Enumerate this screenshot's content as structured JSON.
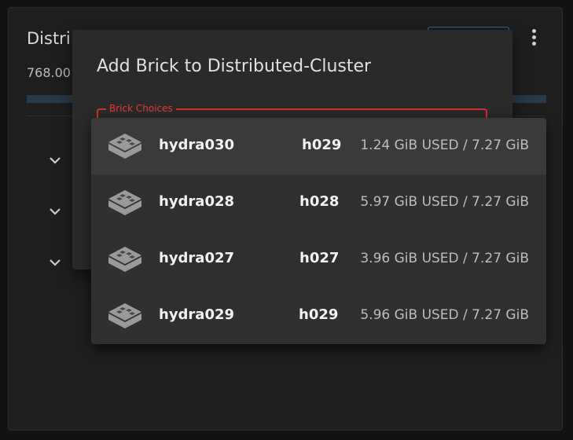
{
  "background_card": {
    "title": "Distri",
    "subtitle": "768.00"
  },
  "dialog": {
    "title": "Add Brick to Distributed-Cluster",
    "field_label": "Brick Choices"
  },
  "brick_choices": [
    {
      "name": "hydra030",
      "host": "h029",
      "usage": "1.24 GiB USED / 7.27 GiB",
      "icon": "brick-icon"
    },
    {
      "name": "hydra028",
      "host": "h028",
      "usage": "5.97 GiB USED / 7.27 GiB",
      "icon": "brick-icon"
    },
    {
      "name": "hydra027",
      "host": "h027",
      "usage": "3.96 GiB USED / 7.27 GiB",
      "icon": "brick-icon"
    },
    {
      "name": "hydra029",
      "host": "h029",
      "usage": "5.96 GiB USED / 7.27 GiB",
      "icon": "brick-icon"
    }
  ],
  "colors": {
    "accent_error": "#d32f2f",
    "accent_blue": "#2f6fa8"
  }
}
